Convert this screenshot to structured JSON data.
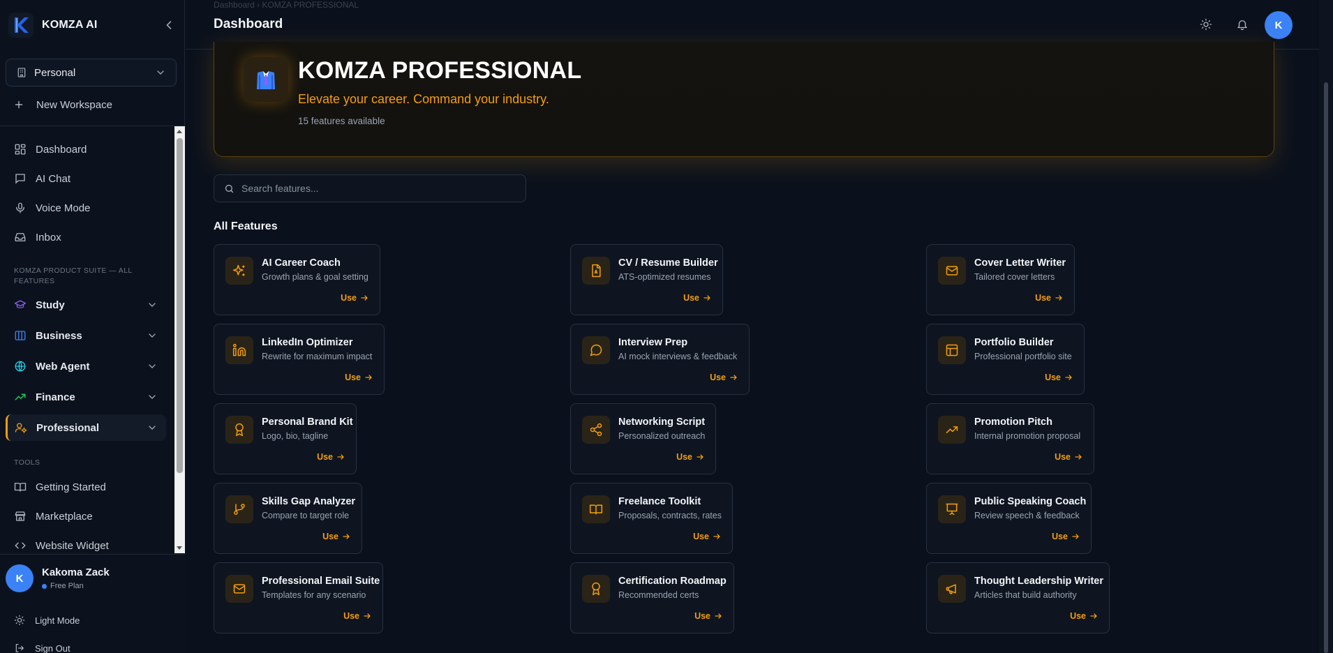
{
  "app": {
    "name": "KOMZA AI"
  },
  "workspace": {
    "selected": "Personal",
    "new_label": "New Workspace"
  },
  "nav": {
    "primary": [
      {
        "label": "Dashboard",
        "icon": "dashboard-icon"
      },
      {
        "label": "AI Chat",
        "icon": "chat-icon"
      },
      {
        "label": "Voice Mode",
        "icon": "mic-icon"
      },
      {
        "label": "Inbox",
        "icon": "inbox-icon"
      }
    ],
    "suite_label": "KOMZA PRODUCT SUITE — ALL FEATURES",
    "groups": [
      {
        "label": "Study",
        "icon": "graduation-cap-icon",
        "color": "#8b5cf6"
      },
      {
        "label": "Business",
        "icon": "building-icon",
        "color": "#3b82f6"
      },
      {
        "label": "Web Agent",
        "icon": "globe-icon",
        "color": "#22d3ee"
      },
      {
        "label": "Finance",
        "icon": "trending-up-icon",
        "color": "#22c55e"
      },
      {
        "label": "Professional",
        "icon": "user-cog-icon",
        "color": "#f59e0b",
        "active": true
      }
    ],
    "tools_label": "TOOLS",
    "tools": [
      {
        "label": "Getting Started",
        "icon": "book-icon"
      },
      {
        "label": "Marketplace",
        "icon": "store-icon"
      },
      {
        "label": "Website Widget",
        "icon": "code-icon"
      }
    ]
  },
  "user": {
    "initial": "K",
    "name": "Kakoma Zack",
    "plan": "Free Plan"
  },
  "bottom": {
    "light_mode": "Light Mode",
    "sign_out": "Sign Out"
  },
  "header": {
    "title": "Dashboard",
    "breadcrumb": "Dashboard  ›  KOMZA PROFESSIONAL",
    "avatar_initial": "K"
  },
  "hero": {
    "title": "KOMZA PROFESSIONAL",
    "subtitle": "Elevate your career. Command your industry.",
    "count": "15 features available"
  },
  "search": {
    "placeholder": "Search features..."
  },
  "features_title": "All Features",
  "use_label": "Use",
  "accent": "#f59e0b",
  "features": [
    {
      "title": "AI Career Coach",
      "desc": "Growth plans & goal setting",
      "icon": "sparkles-icon"
    },
    {
      "title": "CV / Resume Builder",
      "desc": "ATS-optimized resumes",
      "icon": "file-document-icon"
    },
    {
      "title": "Cover Letter Writer",
      "desc": "Tailored cover letters",
      "icon": "mail-icon"
    },
    {
      "title": "LinkedIn Optimizer",
      "desc": "Rewrite for maximum impact",
      "icon": "linkedin-icon"
    },
    {
      "title": "Interview Prep",
      "desc": "AI mock interviews & feedback",
      "icon": "message-circle-icon"
    },
    {
      "title": "Portfolio Builder",
      "desc": "Professional portfolio site",
      "icon": "layout-icon"
    },
    {
      "title": "Personal Brand Kit",
      "desc": "Logo, bio, tagline",
      "icon": "award-icon"
    },
    {
      "title": "Networking Script",
      "desc": "Personalized outreach",
      "icon": "share-icon"
    },
    {
      "title": "Promotion Pitch",
      "desc": "Internal promotion proposal",
      "icon": "trending-up-icon"
    },
    {
      "title": "Skills Gap Analyzer",
      "desc": "Compare to target role",
      "icon": "git-branch-icon"
    },
    {
      "title": "Freelance Toolkit",
      "desc": "Proposals, contracts, rates",
      "icon": "book-open-icon"
    },
    {
      "title": "Public Speaking Coach",
      "desc": "Review speech & feedback",
      "icon": "presentation-icon"
    },
    {
      "title": "Professional Email Suite",
      "desc": "Templates for any scenario",
      "icon": "mail-icon"
    },
    {
      "title": "Certification Roadmap",
      "desc": "Recommended certs",
      "icon": "award-icon"
    },
    {
      "title": "Thought Leadership Writer",
      "desc": "Articles that build authority",
      "icon": "megaphone-icon"
    }
  ]
}
